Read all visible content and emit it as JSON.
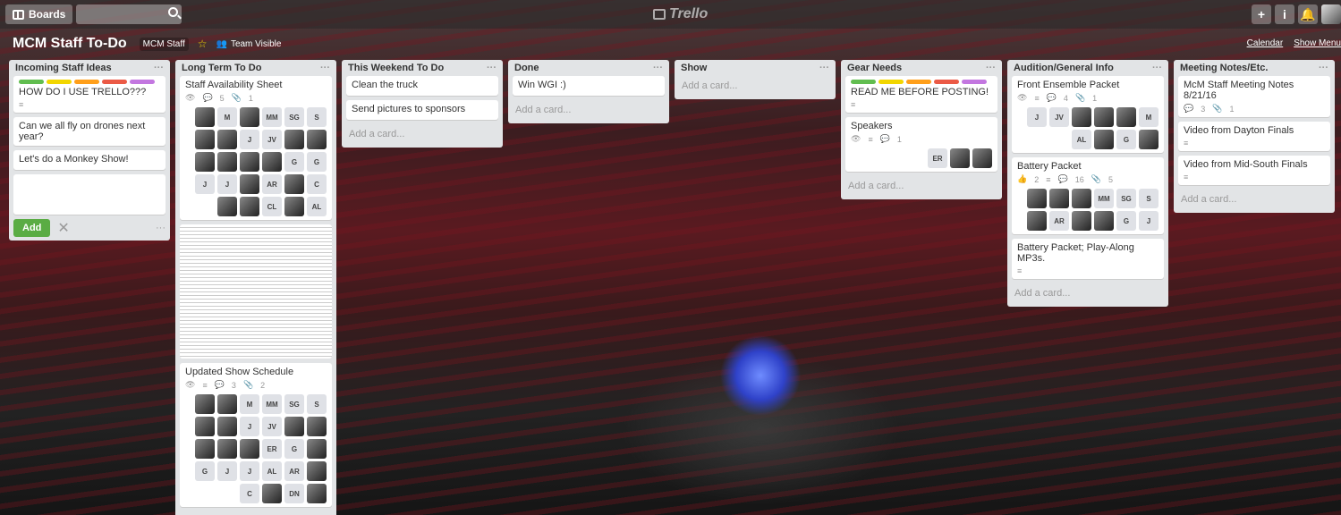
{
  "topbar": {
    "boards_label": "Boards",
    "logo_text": "Trello",
    "plus": "+",
    "info": "i",
    "bell": "🔔"
  },
  "board": {
    "title": "MCM Staff To-Do",
    "team": "MCM Staff",
    "visibility": "Team Visible",
    "calendar": "Calendar",
    "show_menu": "Show Menu"
  },
  "add_card": "Add a card...",
  "lists": {
    "incoming": {
      "title": "Incoming Staff Ideas",
      "card1": "HOW DO I USE TRELLO???",
      "card2": "Can we all fly on drones next year?",
      "card3": "Let's do a Monkey Show!",
      "add": "Add"
    },
    "longterm": {
      "title": "Long Term To Do",
      "card1": "Staff Availability Sheet",
      "card1_badges": {
        "comments": "5",
        "attach": "1"
      },
      "card2": "Updated Show Schedule",
      "card2_badges": {
        "comments": "3",
        "attach": "2"
      },
      "members1": [
        "",
        "M",
        "",
        "MM",
        "SG",
        "S",
        "",
        "",
        "J",
        "JV",
        "",
        "",
        "",
        "",
        "",
        "",
        "G",
        "G",
        "J",
        "J",
        "",
        "AR",
        "",
        "C",
        "",
        "",
        "CL",
        "",
        "AL"
      ],
      "members2": [
        "",
        "",
        "M",
        "MM",
        "SG",
        "S",
        "",
        "",
        "J",
        "JV",
        "",
        "",
        "",
        "",
        "",
        "ER",
        "G",
        "",
        "G",
        "J",
        "J",
        "AL",
        "AR",
        "",
        "C",
        "",
        "DN",
        ""
      ]
    },
    "weekend": {
      "title": "This Weekend To Do",
      "card1": "Clean the truck",
      "card2": "Send pictures to sponsors"
    },
    "done": {
      "title": "Done",
      "card1": "Win WGI :)"
    },
    "show": {
      "title": "Show"
    },
    "gear": {
      "title": "Gear Needs",
      "card1": "READ ME BEFORE POSTING!",
      "card2": "Speakers",
      "card2_comments": "1",
      "members": [
        "ER",
        "",
        ""
      ]
    },
    "audition": {
      "title": "Audition/General Info",
      "card1": "Front Ensemble Packet",
      "card1_comments": "4",
      "card1_attach": "1",
      "members1": [
        "J",
        "JV",
        "",
        "",
        "",
        "M",
        "AL",
        "",
        "G",
        ""
      ],
      "card2": "Battery Packet",
      "card2_badges": {
        "votes": "2",
        "comments": "16",
        "attach": "5"
      },
      "members2": [
        "",
        "",
        "",
        "MM",
        "SG",
        "S",
        "",
        "AR",
        "",
        "",
        "G",
        "J"
      ],
      "card3": "Battery Packet; Play-Along MP3s."
    },
    "notes": {
      "title": "Meeting Notes/Etc.",
      "card1": "McM Staff Meeting Notes 8/21/16",
      "card1_comments": "3",
      "card1_attach": "1",
      "card2": "Video from Dayton Finals",
      "card3": "Video from Mid-South Finals"
    }
  },
  "colors": {
    "green": "#61bd4f",
    "yellow": "#f2d600",
    "orange": "#ff9f1a",
    "red": "#eb5a46",
    "purple": "#c377e0",
    "add_button": "#5aac44"
  }
}
